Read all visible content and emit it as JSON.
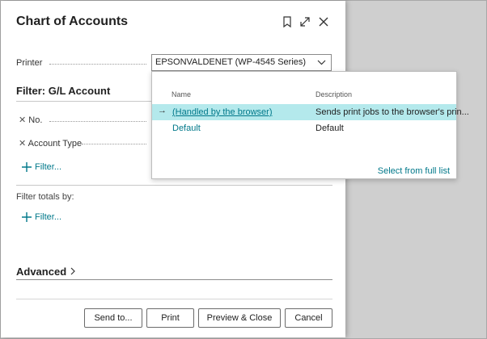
{
  "dialog": {
    "title": "Chart of Accounts",
    "printer": {
      "label": "Printer",
      "value": "EPSONVALDENET (WP-4545 Series)"
    },
    "filter_section": {
      "title": "Filter: G/L Account",
      "fields": [
        "No.",
        "Account Type"
      ],
      "add_filter": "Filter..."
    },
    "totals_section": {
      "title": "Filter totals by:",
      "add_filter": "Filter..."
    },
    "advanced": "Advanced",
    "buttons": {
      "send_to": "Send to...",
      "print": "Print",
      "preview_close": "Preview & Close",
      "cancel": "Cancel"
    }
  },
  "dropdown": {
    "headers": {
      "name": "Name",
      "description": "Description"
    },
    "rows": [
      {
        "name": "(Handled by the browser)",
        "description": "Sends print jobs to the browser's prin...",
        "selected": true
      },
      {
        "name": "Default",
        "description": "Default",
        "selected": false
      }
    ],
    "full_list_link": "Select from full list"
  },
  "colors": {
    "accent": "#00788a",
    "selected_row": "#b4e9ec"
  }
}
